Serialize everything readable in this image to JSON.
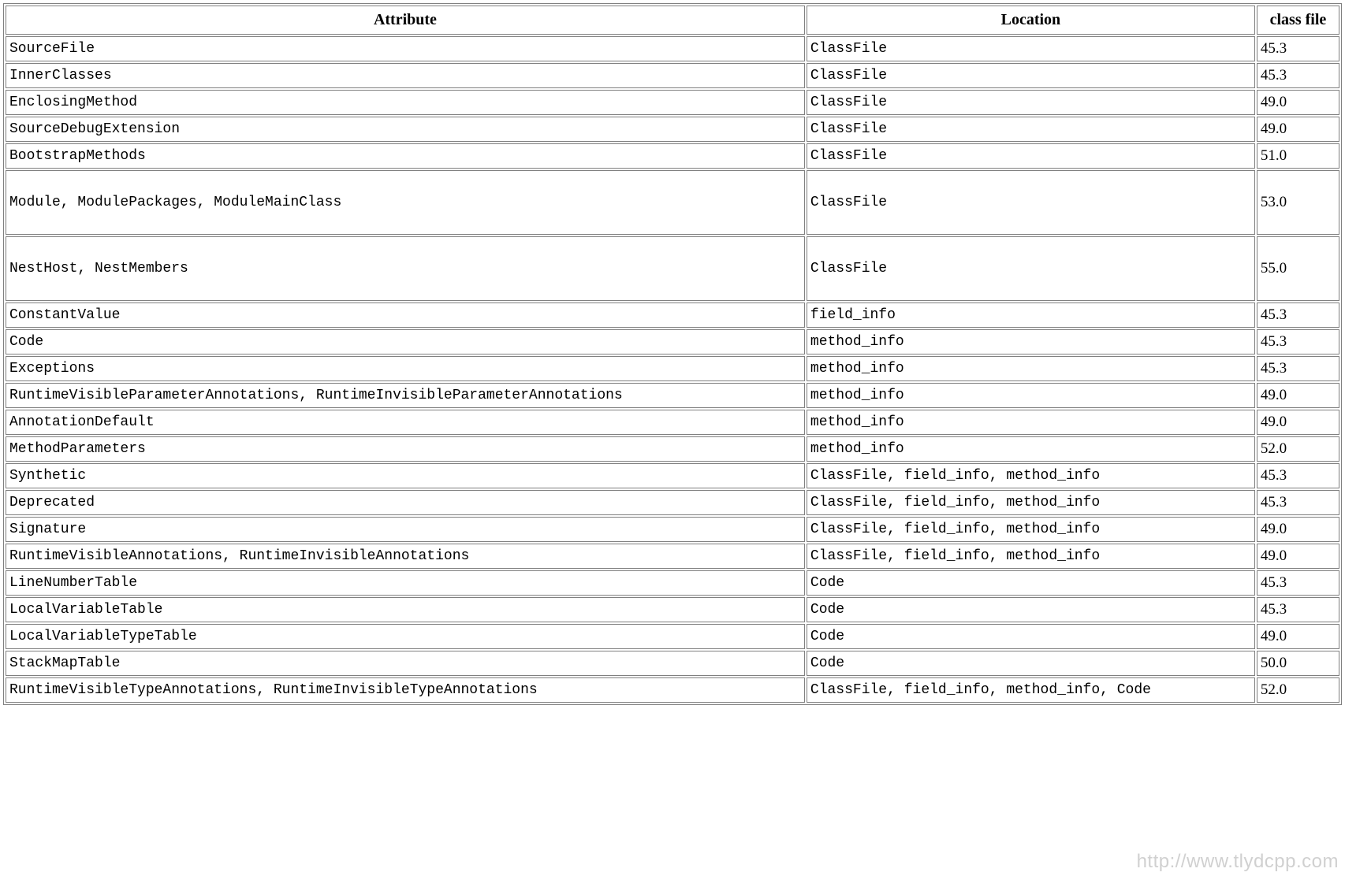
{
  "headers": {
    "attribute": "Attribute",
    "location": "Location",
    "classfile": "class file"
  },
  "rows": [
    {
      "attribute": "SourceFile",
      "location": "ClassFile",
      "classfile": "45.3",
      "tall": false
    },
    {
      "attribute": "InnerClasses",
      "location": "ClassFile",
      "classfile": "45.3",
      "tall": false
    },
    {
      "attribute": "EnclosingMethod",
      "location": "ClassFile",
      "classfile": "49.0",
      "tall": false
    },
    {
      "attribute": "SourceDebugExtension",
      "location": "ClassFile",
      "classfile": "49.0",
      "tall": false
    },
    {
      "attribute": "BootstrapMethods",
      "location": "ClassFile",
      "classfile": "51.0",
      "tall": false
    },
    {
      "attribute": "Module, ModulePackages, ModuleMainClass",
      "location": "ClassFile",
      "classfile": "53.0",
      "tall": true
    },
    {
      "attribute": "NestHost, NestMembers",
      "location": "ClassFile",
      "classfile": "55.0",
      "tall": true
    },
    {
      "attribute": "ConstantValue",
      "location": "field_info",
      "classfile": "45.3",
      "tall": false
    },
    {
      "attribute": "Code",
      "location": "method_info",
      "classfile": "45.3",
      "tall": false
    },
    {
      "attribute": "Exceptions",
      "location": "method_info",
      "classfile": "45.3",
      "tall": false
    },
    {
      "attribute": "RuntimeVisibleParameterAnnotations, RuntimeInvisibleParameterAnnotations",
      "location": "method_info",
      "classfile": "49.0",
      "tall": false
    },
    {
      "attribute": "AnnotationDefault",
      "location": "method_info",
      "classfile": "49.0",
      "tall": false
    },
    {
      "attribute": "MethodParameters",
      "location": "method_info",
      "classfile": "52.0",
      "tall": false
    },
    {
      "attribute": "Synthetic",
      "location": "ClassFile, field_info, method_info",
      "classfile": "45.3",
      "tall": false
    },
    {
      "attribute": "Deprecated",
      "location": "ClassFile, field_info, method_info",
      "classfile": "45.3",
      "tall": false
    },
    {
      "attribute": "Signature",
      "location": "ClassFile, field_info, method_info",
      "classfile": "49.0",
      "tall": false
    },
    {
      "attribute": "RuntimeVisibleAnnotations, RuntimeInvisibleAnnotations",
      "location": "ClassFile, field_info, method_info",
      "classfile": "49.0",
      "tall": false
    },
    {
      "attribute": "LineNumberTable",
      "location": "Code",
      "classfile": "45.3",
      "tall": false
    },
    {
      "attribute": "LocalVariableTable",
      "location": "Code",
      "classfile": "45.3",
      "tall": false
    },
    {
      "attribute": "LocalVariableTypeTable",
      "location": "Code",
      "classfile": "49.0",
      "tall": false
    },
    {
      "attribute": "StackMapTable",
      "location": "Code",
      "classfile": "50.0",
      "tall": false
    },
    {
      "attribute": "RuntimeVisibleTypeAnnotations, RuntimeInvisibleTypeAnnotations",
      "location": "ClassFile, field_info, method_info, Code",
      "classfile": "52.0",
      "tall": false
    }
  ],
  "watermark": "http://www.tlydcpp.com"
}
